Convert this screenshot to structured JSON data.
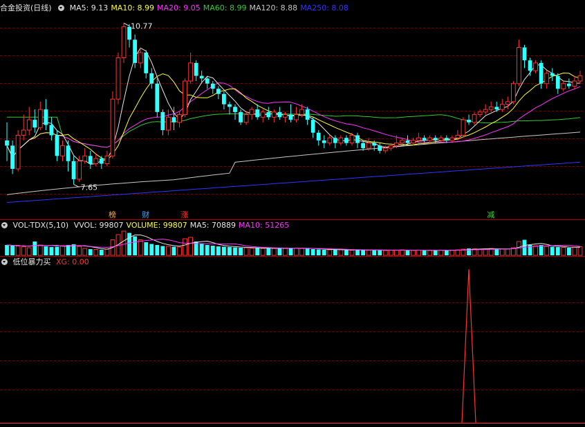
{
  "main_panel": {
    "title": "合金投资(日线)",
    "ma_labels": [
      {
        "text": "MA5: 9.13",
        "color": "#e6e6e6"
      },
      {
        "text": "MA10: 8.99",
        "color": "#ffff33"
      },
      {
        "text": "MA20: 9.05",
        "color": "#ff33ff"
      },
      {
        "text": "MA60: 8.99",
        "color": "#33cc33"
      },
      {
        "text": "MA120: 8.88",
        "color": "#c8c8c8"
      },
      {
        "text": "MA250: 8.08",
        "color": "#3333ff"
      }
    ],
    "high_label": "10.77",
    "low_label": "7.65",
    "markers": [
      {
        "text": "榜",
        "color": "#ffaa33",
        "index": 19
      },
      {
        "text": "财",
        "color": "#33aaff",
        "index": 25
      },
      {
        "text": "涨",
        "color": "#ff3333",
        "index": 32
      },
      {
        "text": "减",
        "color": "#33dd33",
        "index": 87
      }
    ]
  },
  "volume_panel": {
    "title": "VOL-TDX(5,10)",
    "labels": [
      {
        "text": "VVOL: 99807",
        "color": "#e6e6e6"
      },
      {
        "text": "VOLUME: 99807",
        "color": "#ffff33"
      },
      {
        "text": "MA5: 70889",
        "color": "#e6e6e6"
      },
      {
        "text": "MA10: 51265",
        "color": "#ff33ff"
      }
    ]
  },
  "indicator_panel": {
    "title": "低位暴力买",
    "labels": [
      {
        "text": "XG: 0.00",
        "color": "#ff3333"
      }
    ],
    "signal_index": 83
  },
  "colors": {
    "up": "#ff3333",
    "down": "#33ffff",
    "grid": "#7a0000",
    "background": "#000000"
  },
  "chart_data": {
    "type": "candlestick",
    "price_range": [
      7.2,
      10.95
    ],
    "candles": [
      [
        8.5,
        8.4,
        8.85,
        8.1
      ],
      [
        8.4,
        7.95,
        8.5,
        7.85
      ],
      [
        7.95,
        8.6,
        8.7,
        7.9
      ],
      [
        8.6,
        8.7,
        9.0,
        8.5
      ],
      [
        8.7,
        8.9,
        9.15,
        8.6
      ],
      [
        8.9,
        8.75,
        9.1,
        8.65
      ],
      [
        8.75,
        9.1,
        9.25,
        8.7
      ],
      [
        9.1,
        8.8,
        9.3,
        8.7
      ],
      [
        8.8,
        8.6,
        8.95,
        8.5
      ],
      [
        8.6,
        8.2,
        8.7,
        8.1
      ],
      [
        8.2,
        8.4,
        8.5,
        8.1
      ],
      [
        8.4,
        8.1,
        8.5,
        7.9
      ],
      [
        8.1,
        7.75,
        8.2,
        7.65
      ],
      [
        7.75,
        8.1,
        8.2,
        7.7
      ],
      [
        8.1,
        8.2,
        8.35,
        8.05
      ],
      [
        8.2,
        8.05,
        8.3,
        7.95
      ],
      [
        8.05,
        8.15,
        8.25,
        8.0
      ],
      [
        8.15,
        8.05,
        8.2,
        7.95
      ],
      [
        8.05,
        8.2,
        8.3,
        8.0
      ],
      [
        8.2,
        9.3,
        9.45,
        8.15
      ],
      [
        9.3,
        10.1,
        10.2,
        9.2
      ],
      [
        10.1,
        10.7,
        10.77,
        10.0
      ],
      [
        10.7,
        10.45,
        10.75,
        10.3
      ],
      [
        10.45,
        10.0,
        10.55,
        9.9
      ],
      [
        10.0,
        10.2,
        10.3,
        9.9
      ],
      [
        10.2,
        9.8,
        10.25,
        9.7
      ],
      [
        9.8,
        9.6,
        9.9,
        9.5
      ],
      [
        9.6,
        9.05,
        9.7,
        8.95
      ],
      [
        9.05,
        8.7,
        9.1,
        8.6
      ],
      [
        8.7,
        8.95,
        9.1,
        8.6
      ],
      [
        8.95,
        8.85,
        9.15,
        8.7
      ],
      [
        8.85,
        9.0,
        9.05,
        8.75
      ],
      [
        9.0,
        9.65,
        9.7,
        8.95
      ],
      [
        9.65,
        10.0,
        10.2,
        9.6
      ],
      [
        10.0,
        9.75,
        10.05,
        9.65
      ],
      [
        9.75,
        9.7,
        9.85,
        9.6
      ],
      [
        9.7,
        9.6,
        9.75,
        9.5
      ],
      [
        9.6,
        9.5,
        9.65,
        9.4
      ],
      [
        9.5,
        9.4,
        9.55,
        9.3
      ],
      [
        9.4,
        9.2,
        9.45,
        9.1
      ],
      [
        9.2,
        9.15,
        9.25,
        9.0
      ],
      [
        9.15,
        9.05,
        9.2,
        8.9
      ],
      [
        9.05,
        8.85,
        9.1,
        8.8
      ],
      [
        8.85,
        9.0,
        9.05,
        8.8
      ],
      [
        9.0,
        9.1,
        9.15,
        8.9
      ],
      [
        9.1,
        8.95,
        9.2,
        8.9
      ],
      [
        8.95,
        9.05,
        9.1,
        8.85
      ],
      [
        9.05,
        8.95,
        9.15,
        8.9
      ],
      [
        8.95,
        9.05,
        9.1,
        8.85
      ],
      [
        9.05,
        8.95,
        9.15,
        8.9
      ],
      [
        8.95,
        9.0,
        9.05,
        8.85
      ],
      [
        9.0,
        8.9,
        9.2,
        8.85
      ],
      [
        8.9,
        9.0,
        9.15,
        8.85
      ],
      [
        9.0,
        9.1,
        9.2,
        8.95
      ],
      [
        9.1,
        8.9,
        9.15,
        8.8
      ],
      [
        8.9,
        8.65,
        8.95,
        8.55
      ],
      [
        8.65,
        8.5,
        8.7,
        8.4
      ],
      [
        8.5,
        8.45,
        8.6,
        8.35
      ],
      [
        8.45,
        8.55,
        8.6,
        8.4
      ],
      [
        8.55,
        8.45,
        8.6,
        8.35
      ],
      [
        8.45,
        8.55,
        8.6,
        8.4
      ],
      [
        8.55,
        8.45,
        8.6,
        8.4
      ],
      [
        8.45,
        8.6,
        8.65,
        8.4
      ],
      [
        8.6,
        8.45,
        8.65,
        8.35
      ],
      [
        8.45,
        8.35,
        8.5,
        8.3
      ],
      [
        8.35,
        8.45,
        8.55,
        8.3
      ],
      [
        8.45,
        8.4,
        8.5,
        8.3
      ],
      [
        8.4,
        8.3,
        8.45,
        8.25
      ],
      [
        8.3,
        8.35,
        8.4,
        8.25
      ],
      [
        8.35,
        8.4,
        8.45,
        8.3
      ],
      [
        8.4,
        8.45,
        8.6,
        8.35
      ],
      [
        8.45,
        8.5,
        8.55,
        8.4
      ],
      [
        8.5,
        8.45,
        8.6,
        8.4
      ],
      [
        8.45,
        8.5,
        8.55,
        8.4
      ],
      [
        8.5,
        8.55,
        8.65,
        8.45
      ],
      [
        8.55,
        8.5,
        8.6,
        8.45
      ],
      [
        8.5,
        8.55,
        8.6,
        8.45
      ],
      [
        8.55,
        8.5,
        8.6,
        8.45
      ],
      [
        8.5,
        8.55,
        8.6,
        8.45
      ],
      [
        8.55,
        8.5,
        8.6,
        8.45
      ],
      [
        8.5,
        8.55,
        8.6,
        8.45
      ],
      [
        8.55,
        8.6,
        8.7,
        8.5
      ],
      [
        8.6,
        8.9,
        8.95,
        8.55
      ],
      [
        8.9,
        8.85,
        9.0,
        8.8
      ],
      [
        8.85,
        9.0,
        9.05,
        8.8
      ],
      [
        9.0,
        9.05,
        9.1,
        8.95
      ],
      [
        9.05,
        9.1,
        9.2,
        9.0
      ],
      [
        9.1,
        9.15,
        9.25,
        9.05
      ],
      [
        9.15,
        9.1,
        9.25,
        9.05
      ],
      [
        9.1,
        9.2,
        9.3,
        9.05
      ],
      [
        9.2,
        9.25,
        9.35,
        9.1
      ],
      [
        9.25,
        9.6,
        9.65,
        9.2
      ],
      [
        9.6,
        10.3,
        10.45,
        9.55
      ],
      [
        10.3,
        10.05,
        10.35,
        9.9
      ],
      [
        10.05,
        9.85,
        10.1,
        9.75
      ],
      [
        9.85,
        10.0,
        10.05,
        9.8
      ],
      [
        10.0,
        9.6,
        10.05,
        9.5
      ],
      [
        9.6,
        9.8,
        9.85,
        9.5
      ],
      [
        9.8,
        9.75,
        9.9,
        9.65
      ],
      [
        9.75,
        9.5,
        9.8,
        9.4
      ],
      [
        9.5,
        9.6,
        9.65,
        9.45
      ],
      [
        9.6,
        9.55,
        9.7,
        9.5
      ],
      [
        9.55,
        9.65,
        9.75,
        9.5
      ],
      [
        9.65,
        9.75,
        9.85,
        9.6
      ]
    ],
    "volume": [
      30,
      28,
      27,
      25,
      22,
      40,
      30,
      26,
      24,
      25,
      28,
      30,
      32,
      26,
      20,
      18,
      17,
      16,
      18,
      45,
      60,
      70,
      65,
      55,
      45,
      38,
      33,
      30,
      27,
      26,
      25,
      24,
      48,
      52,
      40,
      35,
      30,
      28,
      26,
      25,
      24,
      23,
      22,
      22,
      21,
      21,
      20,
      21,
      20,
      21,
      20,
      22,
      21,
      20,
      19,
      18,
      17,
      16,
      16,
      17,
      16,
      15,
      15,
      16,
      15,
      15,
      16,
      15,
      14,
      15,
      15,
      16,
      15,
      14,
      15,
      15,
      14,
      15,
      15,
      14,
      15,
      16,
      18,
      20,
      19,
      18,
      19,
      20,
      19,
      18,
      18,
      22,
      40,
      45,
      30,
      28,
      30,
      26,
      25,
      24,
      23,
      22,
      24,
      25
    ],
    "xg_signal": {
      "index": 83,
      "value": 1.0
    },
    "ma_latest": {
      "MA5": 9.13,
      "MA10": 8.99,
      "MA20": 9.05,
      "MA60": 8.99,
      "MA120": 8.88,
      "MA250": 8.08
    }
  }
}
